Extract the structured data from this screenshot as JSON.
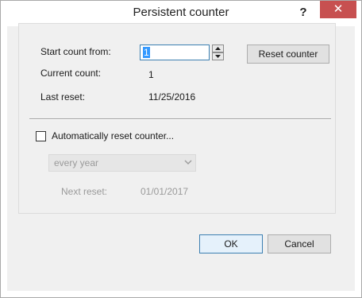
{
  "window": {
    "title": "Persistent counter",
    "help_label": "?",
    "close_label": "✕"
  },
  "counter": {
    "start_label": "Start count from:",
    "start_value": "1",
    "reset_button": "Reset counter",
    "current_label": "Current count:",
    "current_value": "1",
    "last_reset_label": "Last reset:",
    "last_reset_value": "11/25/2016"
  },
  "auto_reset": {
    "checkbox_label": "Automatically reset counter...",
    "checked": false,
    "frequency_selected": "every year",
    "next_reset_label": "Next reset:",
    "next_reset_value": "01/01/2017"
  },
  "footer": {
    "ok_label": "OK",
    "cancel_label": "Cancel"
  },
  "colors": {
    "close_button": "#c75050",
    "focus_border": "#3c7fb1",
    "selection": "#3399ff",
    "client_bg": "#f0f0f0"
  }
}
